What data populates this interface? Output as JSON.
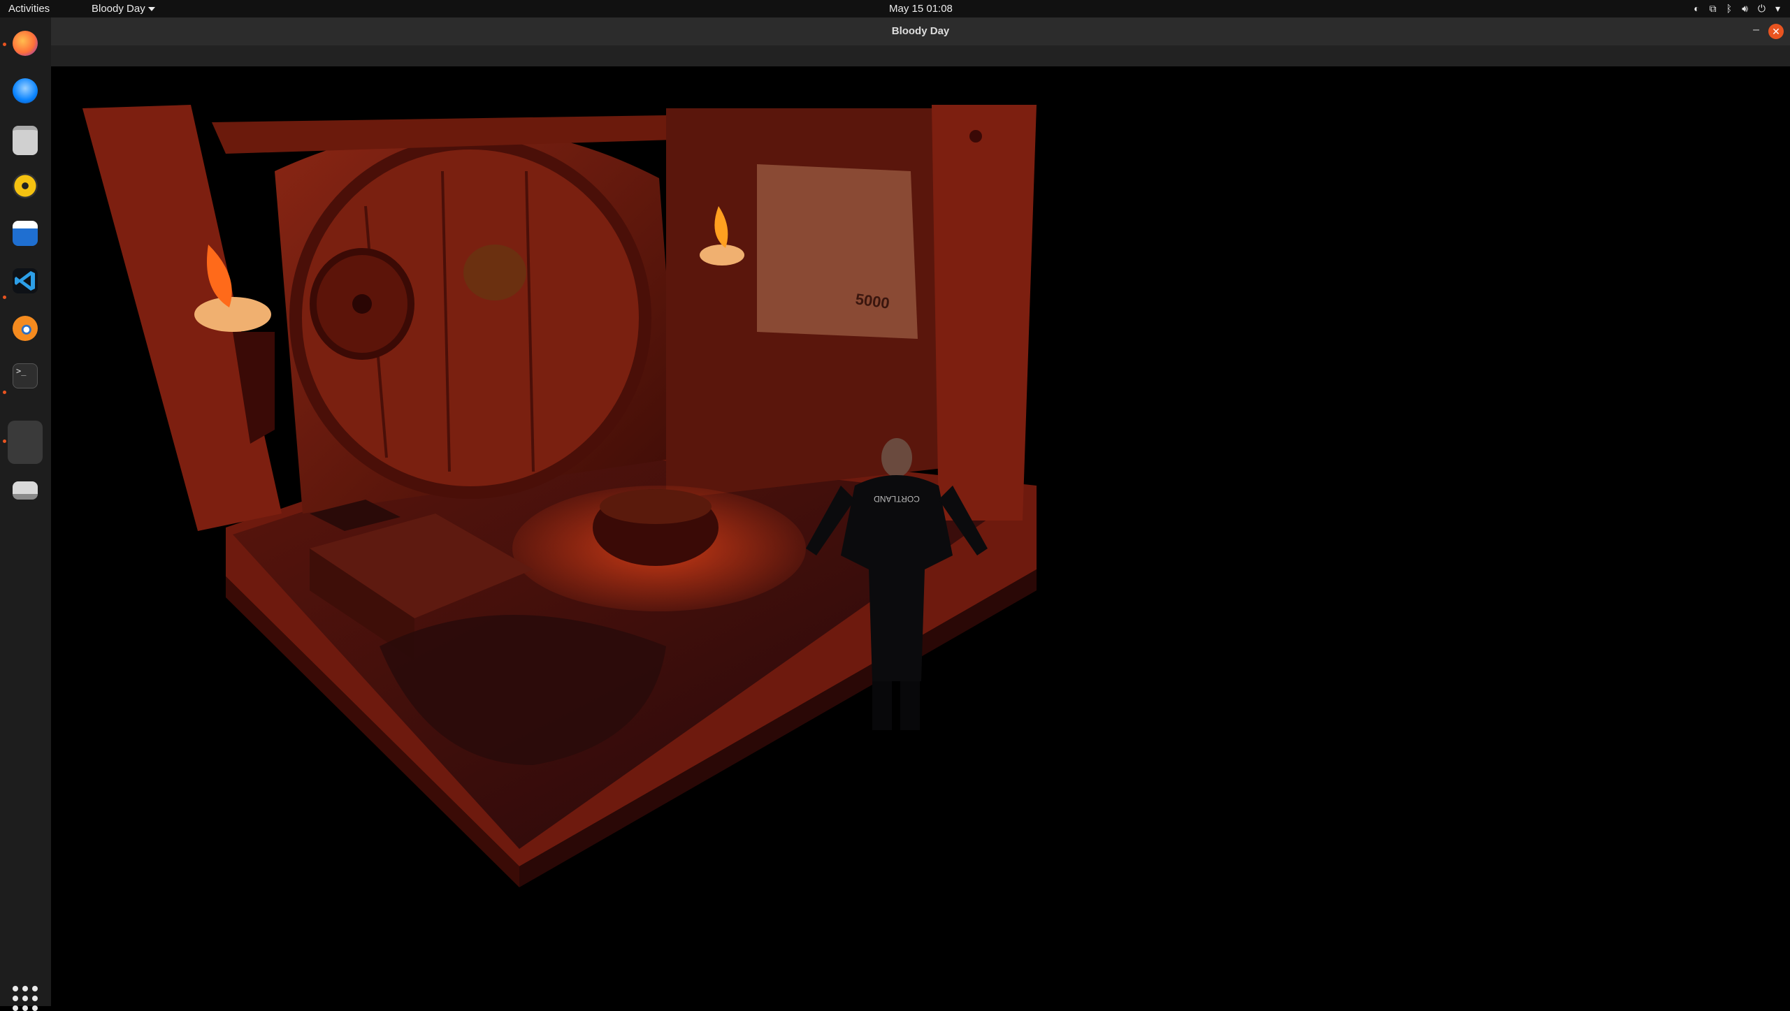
{
  "topbar": {
    "activities": "Activities",
    "app_menu": "Bloody Day",
    "clock": "May 15  01:08"
  },
  "window": {
    "title": "Bloody Day",
    "minimize": "–",
    "close": "✕"
  },
  "dock": {
    "items": [
      {
        "name": "firefox-icon",
        "color": "#ff7139"
      },
      {
        "name": "thunderbird-icon",
        "color": "#0a84ff"
      },
      {
        "name": "files-icon",
        "color": "#cfcfcf"
      },
      {
        "name": "rhythmbox-icon",
        "color": "#f5c211"
      },
      {
        "name": "writer-icon",
        "color": "#1f6fd1"
      },
      {
        "name": "vscode-icon",
        "color": "#2d9fe8"
      },
      {
        "name": "blender-icon",
        "color": "#f58b1f"
      },
      {
        "name": "terminal-icon",
        "color": "#2e2e2e"
      },
      {
        "name": "game-window-icon",
        "color": "#3a3a3a"
      },
      {
        "name": "drive-icon",
        "color": "#bdbdbd"
      }
    ]
  },
  "tray_icons": [
    "steam-icon",
    "network-icon",
    "bluetooth-icon",
    "volume-icon",
    "power-icon",
    "chevron-down-icon"
  ],
  "scene": {
    "poster_text": "5000",
    "jacket_text": "CORTLAND"
  }
}
